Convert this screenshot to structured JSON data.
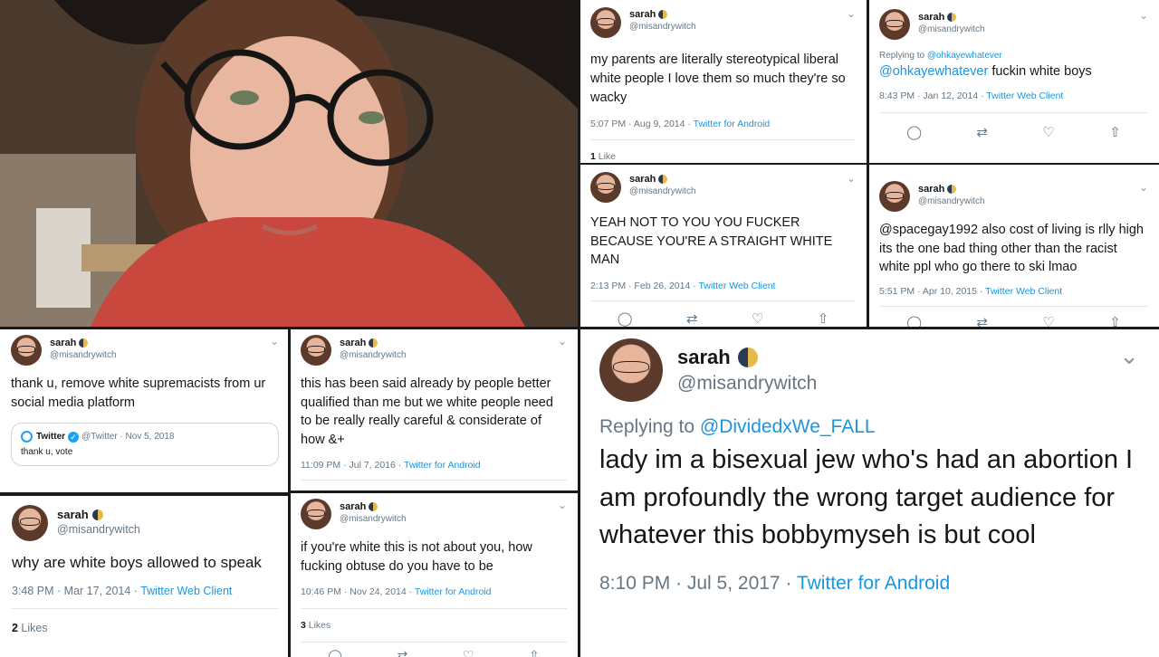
{
  "tweets": [
    {
      "name": "sarah",
      "handle": "@misandrywitch",
      "text": "my parents are literally stereotypical liberal white people I love them so much they're so wacky",
      "time": "5:07 PM · Aug 9, 2014 · ",
      "source": "Twitter for Android",
      "likes_count": "1",
      "likes_label": " Like"
    },
    {
      "name": "sarah",
      "handle": "@misandrywitch",
      "reply_prefix": "Replying to ",
      "reply_to": "@ohkayewhatever",
      "mention": "@ohkayewhatever",
      "text": " fuckin white boys",
      "time": "8:43 PM · Jan 12, 2014 · ",
      "source": "Twitter Web Client"
    },
    {
      "name": "sarah",
      "handle": "@misandrywitch",
      "text": "YEAH NOT TO YOU YOU FUCKER BECAUSE YOU'RE A STRAIGHT WHITE MAN",
      "time": "2:13 PM · Feb 26, 2014 · ",
      "source": "Twitter Web Client"
    },
    {
      "name": "sarah",
      "handle": "@misandrywitch",
      "text": "@spacegay1992 also cost of living is rlly high its the one bad thing other than the racist white ppl who go there to ski lmao",
      "time": "5:51 PM · Apr 10, 2015 · ",
      "source": "Twitter Web Client"
    },
    {
      "name": "sarah",
      "handle": "@misandrywitch",
      "text": "thank u, remove white supremacists from ur social media platform",
      "quote_name": "Twitter",
      "quote_handle": "@Twitter · Nov 5, 2018",
      "quote_text": "thank u, vote"
    },
    {
      "name": "sarah",
      "handle": "@misandrywitch",
      "text": "this has been said already by people better qualified than me but we white people need to be really really careful & considerate of how &+",
      "time": "11:09 PM · Jul 7, 2016 · ",
      "source": "Twitter for Android"
    },
    {
      "name": "sarah",
      "handle": "@misandrywitch",
      "text": "why are white boys allowed to speak",
      "time": "3:48 PM · Mar 17, 2014 · ",
      "source": "Twitter Web Client",
      "likes_count": "2",
      "likes_label": " Likes"
    },
    {
      "name": "sarah",
      "handle": "@misandrywitch",
      "text": "if you're white this is not about you, how fucking obtuse do you have to be",
      "time": "10:46 PM · Nov 24, 2014 · ",
      "source": "Twitter for Android",
      "likes_count": "3",
      "likes_label": " Likes"
    },
    {
      "name": "sarah",
      "handle": "@misandrywitch",
      "reply_prefix": "Replying to ",
      "reply_to": "@DividedxWe_FALL",
      "text": "lady im a bisexual jew who's had an abortion I am profoundly the wrong target audience for whatever this bobbymyseh is but cool",
      "time": "8:10 PM · Jul 5, 2017 · ",
      "source": "Twitter for Android"
    }
  ],
  "icons": {
    "chevron": "⌄",
    "reply": "◯",
    "retweet": "⇄",
    "like": "♡",
    "share": "⇧",
    "verified": "✓"
  },
  "colors": {
    "link": "#1b95e0",
    "meta": "#657786",
    "text": "#14171a"
  }
}
